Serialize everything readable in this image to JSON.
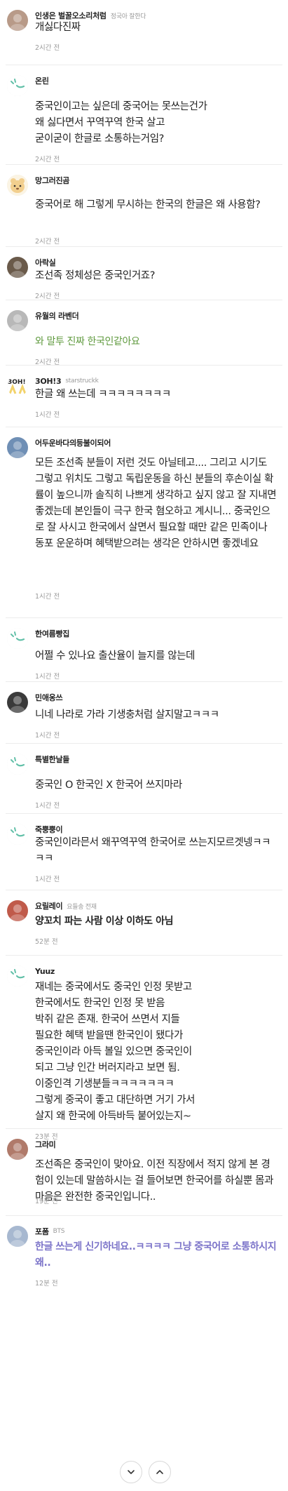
{
  "comments": [
    {
      "author": "인생은 벌꿀오소리처럼",
      "tag": "정국아 잘한다",
      "body": "개싫다진짜",
      "time": "2시간 전",
      "style": "",
      "avatar": "photo-avatar",
      "avatarColor": "#b89a88"
    },
    {
      "author": "온린",
      "tag": "",
      "body": "중국인이고는 싶은데 중국어는 못쓰는건가\n왜 싫다면서 꾸역꾸역 한국 살고\n굳이굳이 한글로 소통하는거임?",
      "time": "2시간 전",
      "style": "",
      "avatar": "default-avatar",
      "avatarColor": "#ffffff"
    },
    {
      "author": "망그러진곰",
      "tag": "",
      "body": "중국어로 해 그렇게 무시하는 한국의 한글은 왜 사용함?",
      "time": "2시간 전",
      "style": "",
      "avatar": "bear-avatar",
      "avatarColor": "#f7e8c8"
    },
    {
      "author": "아락실",
      "tag": "",
      "body": "조선족 정체성은 중국인거죠?",
      "time": "2시간 전",
      "style": "",
      "avatar": "photo-avatar",
      "avatarColor": "#6a5a4a"
    },
    {
      "author": "유월의 라벤더",
      "tag": "",
      "body": "와 말투 진짜 한국인같아요",
      "time": "2시간 전",
      "style": "green",
      "avatar": "photo-avatar",
      "avatarColor": "#b8b8b8"
    },
    {
      "author": "3OH!3",
      "tag": "starstruckk",
      "body": "한글 왜 쓰는데 ㅋㅋㅋㅋㅋㅋㅋㅋ",
      "time": "1시간 전",
      "style": "",
      "avatar": "text-avatar",
      "avatarColor": "#f2d26a"
    },
    {
      "author": "어두운바다의등불이되어",
      "tag": "",
      "body": "모든 조선족 분들이 저런 것도 아닐테고.... 그리고 시기도 그렇고 위치도 그렇고 독립운동을 하신 분들의 후손이실 확률이 높으니까 솔직히 나쁘게 생각하고 싶지 않고 잘 지내면 좋겠는데 본인들이 극구 한국 혐오하고 계시니... 중국인으로 잘 사시고 한국에서 살면서 필요할 때만 같은 민족이나 동포 운운하며 혜택받으려는 생각은 안하시면 좋겠네요",
      "time": "1시간 전",
      "style": "",
      "avatar": "photo-avatar",
      "avatarColor": "#6f8fb5"
    },
    {
      "author": "한여름빵집",
      "tag": "",
      "body": "어쩔 수 있나요 출산율이 늘지를 않는데",
      "time": "1시간 전",
      "style": "",
      "avatar": "default-avatar",
      "avatarColor": "#ffffff"
    },
    {
      "author": "민애옹쓰",
      "tag": "",
      "body": "니네 나라로 가라 기생충처럼 살지말고ㅋㅋㅋ",
      "time": "1시간 전",
      "style": "",
      "avatar": "photo-avatar",
      "avatarColor": "#3a3a3a"
    },
    {
      "author": "특별한날들",
      "tag": "",
      "body": "중국인 O 한국인 X 한국어 쓰지마라",
      "time": "1시간 전",
      "style": "",
      "avatar": "default-avatar",
      "avatarColor": "#ffffff"
    },
    {
      "author": "죽뿡뿡이",
      "tag": "",
      "body": "중국인이라믄서 왜꾸역꾸역 한국어로 쓰는지모르겟넹ㅋㅋㅋㅋ",
      "time": "1시간 전",
      "style": "",
      "avatar": "default-avatar",
      "avatarColor": "#ffffff"
    },
    {
      "author": "요릴레이",
      "tag": "요들송 전재",
      "body": "양꼬치 파는 사람 이상 이하도 아님",
      "time": "52분 전",
      "style": "bold",
      "avatar": "photo-avatar",
      "avatarColor": "#c05a4a"
    },
    {
      "author": "Yuuz",
      "tag": "",
      "body": "재네는 중국에서도 중국인 인정 못받고\n한국에서도 한국인 인정 못 받음\n박쥐 같은 존재. 한국어 쓰면서 지들\n필요한 혜택 받을땐 한국인이 됐다가\n중국인이라 아득 볼일 있으면 중국인이\n되고 그냥 인간 버러지라고 보면 됨.\n이중인격 기생분들ㅋㅋㅋㅋㅋㅋㅋ\n그렇게 중국이 좋고 대단하면 거기 가서\n살지 왜 한국에 아득바득 붙어있는지~",
      "time": "23분 전",
      "style": "",
      "avatar": "default-avatar",
      "avatarColor": "#ffffff"
    },
    {
      "author": "그라미",
      "tag": "",
      "body": "조선족은 중국인이 맞아요. 이전 직장에서 적지 않게 본 경험이 있는데 말씀하시는 걸 들어보면 한국어를 하실뿐 몸과 마음은 완전한 중국인입니다..",
      "time": "19분 전",
      "style": "",
      "avatar": "photo-avatar",
      "avatarColor": "#b07a6a"
    },
    {
      "author": "포폼",
      "tag": "BTS",
      "body": "한글 쓰는게 신기하네요..ㅋㅋㅋㅋ 그냥 중국어로 소통하시지 왜..",
      "time": "12분 전",
      "style": "purple",
      "avatar": "photo-avatar",
      "avatarColor": "#a7b8d0"
    }
  ],
  "nav": {
    "down": "chevron-down-icon",
    "up": "chevron-up-icon"
  }
}
